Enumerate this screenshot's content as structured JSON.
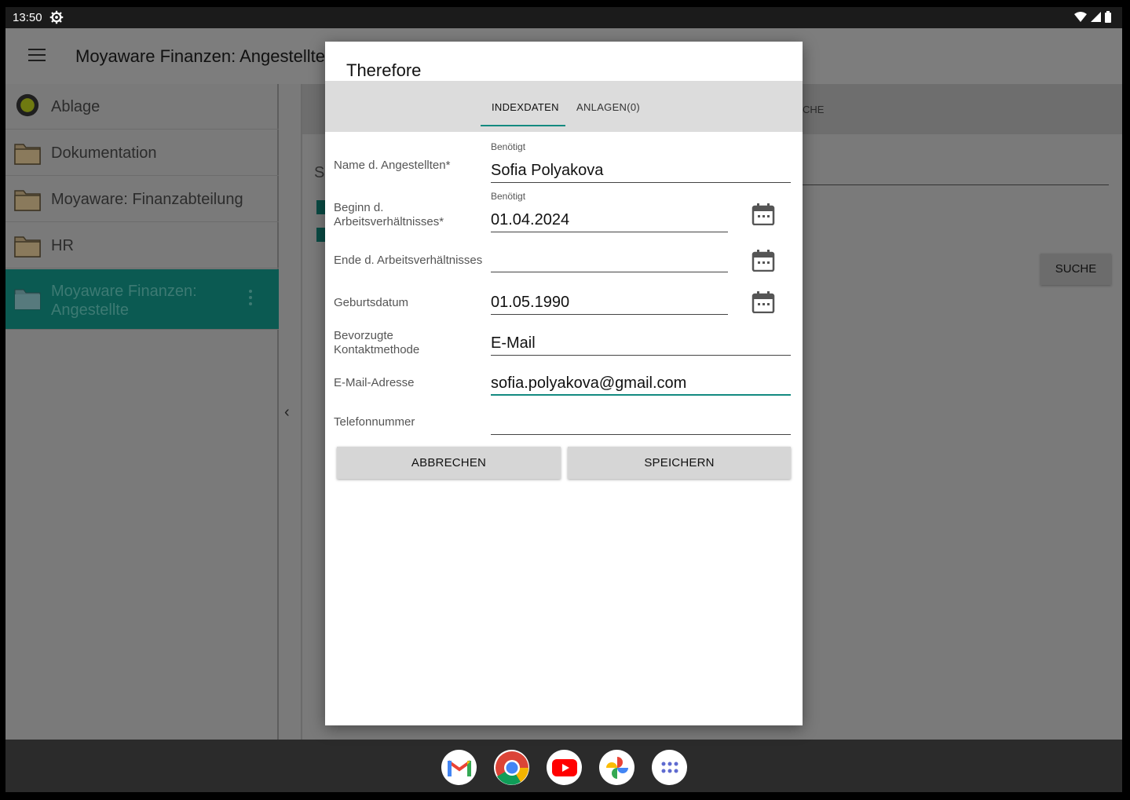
{
  "status": {
    "time": "13:50"
  },
  "app": {
    "title": "Moyaware Finanzen: Angestellte"
  },
  "sidebar": {
    "items": [
      {
        "label": "Ablage"
      },
      {
        "label": "Dokumentation"
      },
      {
        "label": "Moyaware: Finanzabteilung"
      },
      {
        "label": "HR"
      },
      {
        "label": "Moyaware Finanzen: Angestellte"
      }
    ]
  },
  "background": {
    "tab_fragment": "CHE",
    "search_fragment": "S",
    "search_button": "SUCHE"
  },
  "dialog": {
    "title": "Therefore",
    "tabs": [
      {
        "label": "INDEXDATEN"
      },
      {
        "label": "ANLAGEN(0)"
      }
    ],
    "fields": {
      "name": {
        "label": "Name d. Angestellten*",
        "hint": "Benötigt",
        "value": "Sofia Polyakova"
      },
      "start": {
        "label_line1": "Beginn d.",
        "label_line2": "Arbeitsverhältnisses*",
        "hint": "Benötigt",
        "value": "01.04.2024"
      },
      "end": {
        "label": "Ende d. Arbeitsverhältnisses",
        "value": ""
      },
      "birth": {
        "label": "Geburtsdatum",
        "value": "01.05.1990"
      },
      "contact": {
        "label_line1": "Bevorzugte",
        "label_line2": "Kontaktmethode",
        "value": "E-Mail"
      },
      "email": {
        "label": "E-Mail-Adresse",
        "value": "sofia.polyakova@gmail.com"
      },
      "phone": {
        "label": "Telefonnummer",
        "value": ""
      }
    },
    "buttons": {
      "cancel": "ABBRECHEN",
      "save": "SPEICHERN"
    }
  },
  "colors": {
    "accent": "#138a80",
    "sidebar_active": "#0b5a52"
  },
  "dock": {
    "apps": [
      "gmail-icon",
      "chrome-icon",
      "youtube-icon",
      "photos-icon",
      "apps-grid-icon"
    ]
  }
}
